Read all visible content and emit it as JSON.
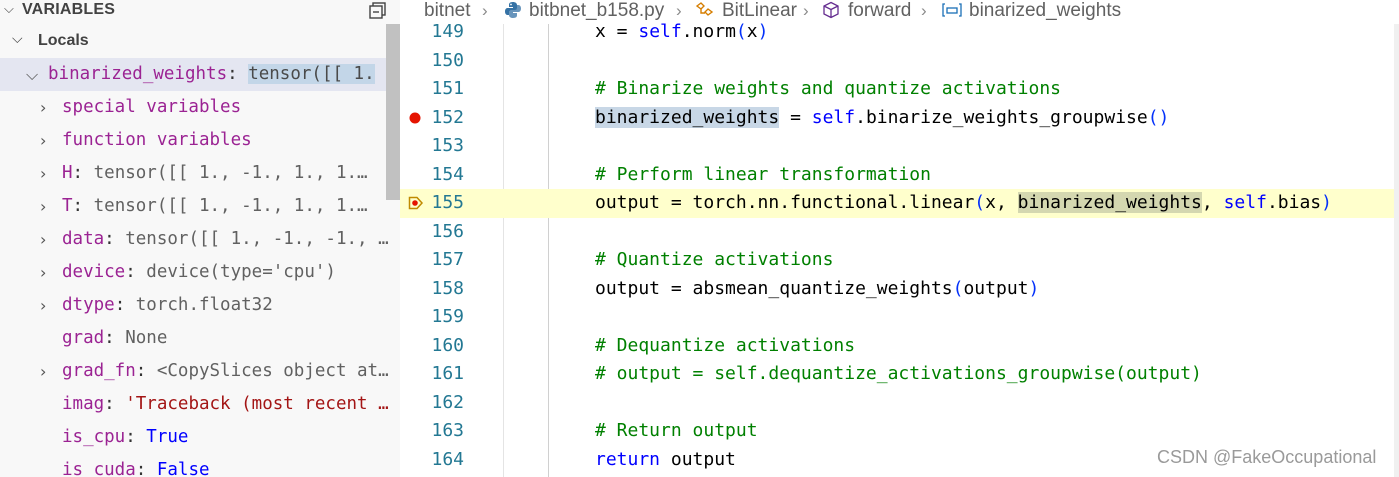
{
  "sidebar": {
    "section_title": "VARIABLES",
    "scope_title": "Locals",
    "variables": [
      {
        "name": "binarized_weights",
        "sep": ": ",
        "value": "tensor([[ 1.",
        "value_type": "sel",
        "expandable": true,
        "expanded": true,
        "depth": 0
      },
      {
        "name": "special variables",
        "sep": "",
        "value": "",
        "value_type": "plain",
        "expandable": true,
        "expanded": false,
        "depth": 1
      },
      {
        "name": "function variables",
        "sep": "",
        "value": "",
        "value_type": "plain",
        "expandable": true,
        "expanded": false,
        "depth": 1
      },
      {
        "name": "H",
        "sep": ": ",
        "value": "tensor([[ 1., -1.,  1.,  1.…",
        "value_type": "plain",
        "expandable": true,
        "expanded": false,
        "depth": 1
      },
      {
        "name": "T",
        "sep": ": ",
        "value": "tensor([[ 1., -1.,  1.,  1.…",
        "value_type": "plain",
        "expandable": true,
        "expanded": false,
        "depth": 1
      },
      {
        "name": "data",
        "sep": ": ",
        "value": "tensor([[ 1., -1., -1., …",
        "value_type": "plain",
        "expandable": true,
        "expanded": false,
        "depth": 1
      },
      {
        "name": "device",
        "sep": ": ",
        "value": "device(type='cpu')",
        "value_type": "plain",
        "expandable": true,
        "expanded": false,
        "depth": 1
      },
      {
        "name": "dtype",
        "sep": ": ",
        "value": "torch.float32",
        "value_type": "plain",
        "expandable": true,
        "expanded": false,
        "depth": 1
      },
      {
        "name": "grad",
        "sep": ": ",
        "value": "None",
        "value_type": "plain",
        "expandable": false,
        "expanded": false,
        "depth": 1
      },
      {
        "name": "grad_fn",
        "sep": ": ",
        "value": "<CopySlices object at…",
        "value_type": "plain",
        "expandable": true,
        "expanded": false,
        "depth": 1
      },
      {
        "name": "imag",
        "sep": ": ",
        "value": "'Traceback (most recent …",
        "value_type": "str",
        "expandable": false,
        "expanded": false,
        "depth": 1
      },
      {
        "name": "is_cpu",
        "sep": ": ",
        "value": "True",
        "value_type": "kw",
        "expandable": false,
        "expanded": false,
        "depth": 1
      },
      {
        "name": "is_cuda",
        "sep": ": ",
        "value": "False",
        "value_type": "kw",
        "expandable": false,
        "expanded": false,
        "depth": 1
      }
    ]
  },
  "breadcrumb": {
    "items": [
      "bitnet",
      "bitbnet_b158.py",
      "BitLinear",
      "forward",
      "binarized_weights"
    ]
  },
  "editor": {
    "current_line": 155,
    "breakpoint_line": 152,
    "lines": [
      {
        "num": "149",
        "tokens": [
          [
            "var",
            "x = "
          ],
          [
            "self",
            "self"
          ],
          [
            "fn",
            ".norm"
          ],
          [
            "paren",
            "("
          ],
          [
            "var",
            "x"
          ],
          [
            "paren",
            ")"
          ]
        ]
      },
      {
        "num": "150",
        "tokens": []
      },
      {
        "num": "151",
        "tokens": [
          [
            "cm",
            "# Binarize weights and quantize activations"
          ]
        ]
      },
      {
        "num": "152",
        "tokens": [
          [
            "hl",
            "binarized_weights"
          ],
          [
            "var",
            " = "
          ],
          [
            "self",
            "self"
          ],
          [
            "fn",
            ".binarize_weights_groupwise"
          ],
          [
            "paren",
            "()"
          ]
        ]
      },
      {
        "num": "153",
        "tokens": []
      },
      {
        "num": "154",
        "tokens": [
          [
            "cm",
            "# Perform linear transformation"
          ]
        ]
      },
      {
        "num": "155",
        "tokens": [
          [
            "var",
            "output = torch.nn.functional.linear"
          ],
          [
            "paren",
            "("
          ],
          [
            "var",
            "x, "
          ],
          [
            "hl2",
            "binarized_weights"
          ],
          [
            "var",
            ", "
          ],
          [
            "self",
            "self"
          ],
          [
            "var",
            ".bias"
          ],
          [
            "paren",
            ")"
          ]
        ]
      },
      {
        "num": "156",
        "tokens": []
      },
      {
        "num": "157",
        "tokens": [
          [
            "cm",
            "# Quantize activations"
          ]
        ]
      },
      {
        "num": "158",
        "tokens": [
          [
            "var",
            "output = absmean_quantize_weights"
          ],
          [
            "paren",
            "("
          ],
          [
            "var",
            "output"
          ],
          [
            "paren",
            ")"
          ]
        ]
      },
      {
        "num": "159",
        "tokens": []
      },
      {
        "num": "160",
        "tokens": [
          [
            "cm",
            "# Dequantize activations"
          ]
        ]
      },
      {
        "num": "161",
        "tokens": [
          [
            "cm",
            "# output = self.dequantize_activations_groupwise(output)"
          ]
        ]
      },
      {
        "num": "162",
        "tokens": []
      },
      {
        "num": "163",
        "tokens": [
          [
            "cm",
            "# Return output"
          ]
        ]
      },
      {
        "num": "164",
        "tokens": [
          [
            "kw",
            "return"
          ],
          [
            "var",
            " output"
          ]
        ]
      }
    ]
  },
  "watermark": "CSDN @FakeOccupational",
  "icons": {
    "collapse_all": "collapse-all-icon",
    "python_file": "python-file-icon",
    "class": "class-icon",
    "method": "method-icon",
    "variable": "variable-icon",
    "breakpoint": "breakpoint-icon",
    "current_frame": "stack-frame-icon"
  },
  "colors": {
    "breakpoint": "#e51400",
    "current_line_bg": "#ffffcc",
    "selection_bg": "#e4e6f1",
    "comment": "#008000",
    "keyword": "#0000ff",
    "line_number": "#237893"
  }
}
